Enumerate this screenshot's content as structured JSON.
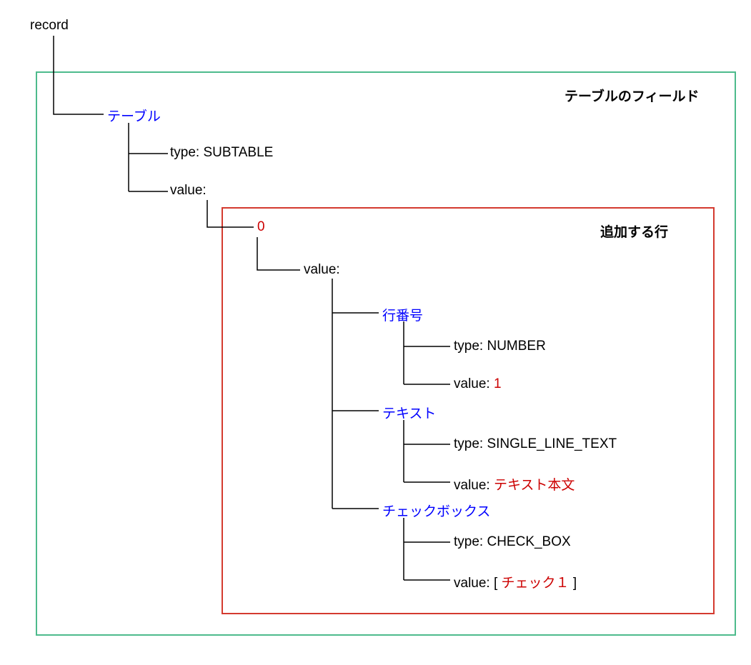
{
  "root": "record",
  "boxes": {
    "green_label": "テーブルのフィールド",
    "red_label": "追加する行"
  },
  "tree": {
    "table": "テーブル",
    "table_type_key": "type: ",
    "table_type_val": "SUBTABLE",
    "table_value_key": "value:",
    "index": "0",
    "row_value_key": "value:",
    "field1_name": "行番号",
    "field1_type_key": "type: ",
    "field1_type_val": "NUMBER",
    "field1_value_key": "value: ",
    "field1_value_val": "1",
    "field2_name": "テキスト",
    "field2_type_key": "type: ",
    "field2_type_val": "SINGLE_LINE_TEXT",
    "field2_value_key": "value: ",
    "field2_value_val": "テキスト本文",
    "field3_name": "チェックボックス",
    "field3_type_key": "type: ",
    "field3_type_val": "CHECK_BOX",
    "field3_value_key": "value: [ ",
    "field3_value_val": "チェック１",
    "field3_value_close": " ]"
  }
}
